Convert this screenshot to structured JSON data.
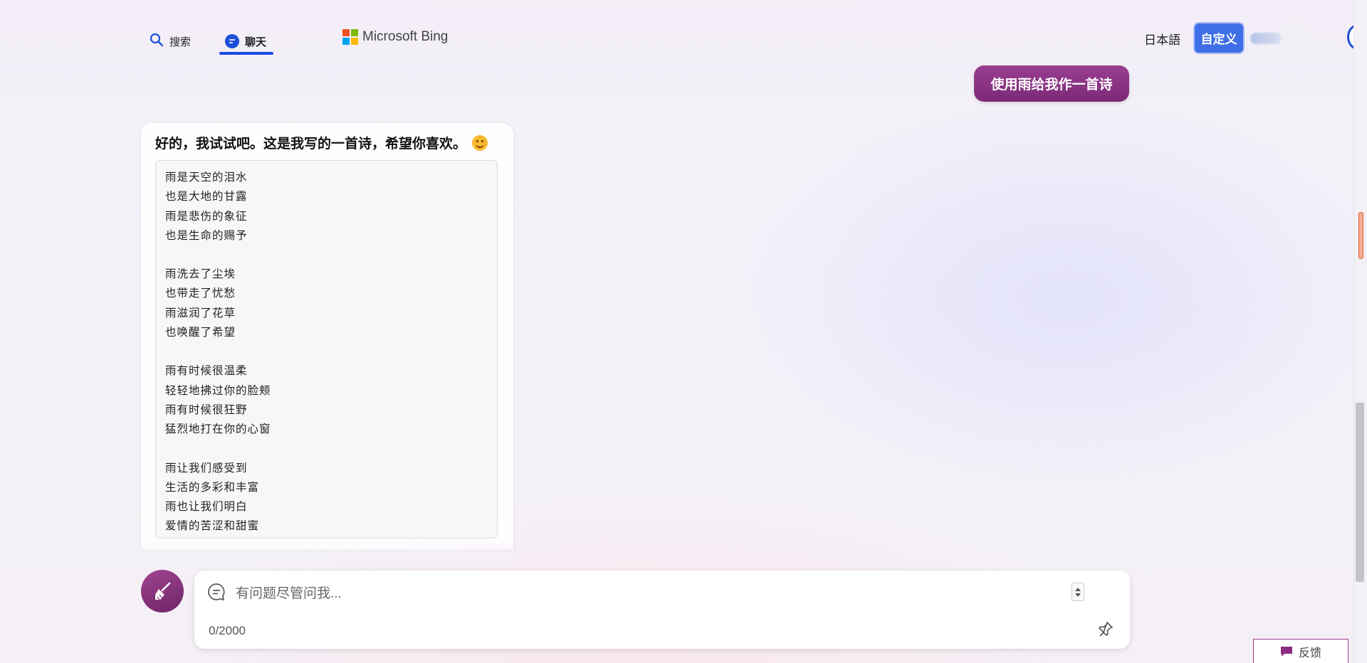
{
  "header": {
    "tabs": [
      {
        "label": "搜索",
        "icon": "search-icon",
        "active": false
      },
      {
        "label": "聊天",
        "icon": "chat-icon",
        "active": true
      }
    ],
    "brand": "Microsoft Bing",
    "language_link": "日本語",
    "customize_label": "自定义"
  },
  "conversation": {
    "user_message": "使用雨给我作一首诗",
    "bot_intro": "好的，我试试吧。这是我写的一首诗，希望你喜欢。",
    "poem": [
      [
        "雨是天空的泪水",
        "也是大地的甘露",
        "雨是悲伤的象征",
        "也是生命的赐予"
      ],
      [
        "雨洗去了尘埃",
        "也带走了忧愁",
        "雨滋润了花草",
        "也唤醒了希望"
      ],
      [
        "雨有时候很温柔",
        "轻轻地拂过你的脸颊",
        "雨有时候很狂野",
        "猛烈地打在你的心窗"
      ],
      [
        "雨让我们感受到",
        "生活的多彩和丰富",
        "雨也让我们明白",
        "爱情的苦涩和甜蜜"
      ]
    ]
  },
  "composer": {
    "placeholder": "有问题尽管问我...",
    "char_count": "0/2000"
  },
  "feedback_label": "反馈",
  "colors": {
    "accent_blue": "#174ae4",
    "user_bubble": "#8b3482",
    "customize_button": "#3f6fe7"
  }
}
